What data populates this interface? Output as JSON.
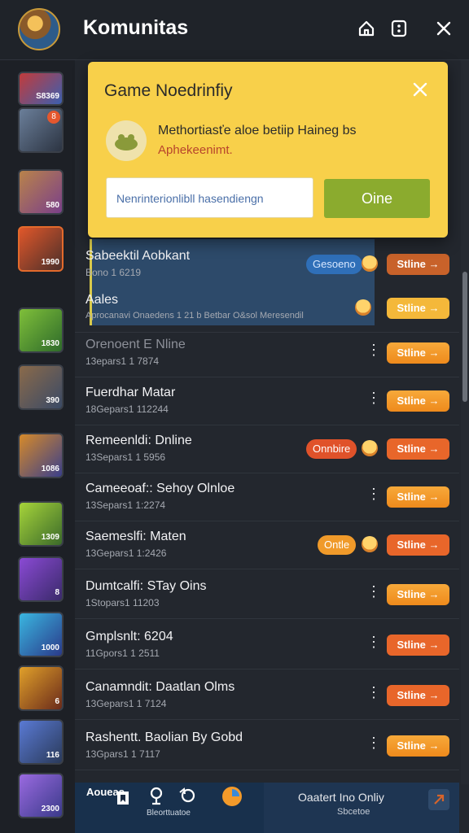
{
  "header": {
    "title": "Komunitas",
    "icons": [
      "home-icon",
      "dice-icon",
      "close-icon"
    ]
  },
  "rail": {
    "avatars": [
      {
        "badge": "S8369"
      },
      {
        "badge": "",
        "count": "8"
      },
      {
        "badge": "580"
      },
      {
        "badge": "1990"
      },
      {
        "badge": "1830"
      },
      {
        "badge": "390"
      },
      {
        "badge": "1086"
      },
      {
        "badge": "1309"
      },
      {
        "badge": "8"
      },
      {
        "badge": "1000"
      },
      {
        "badge": "6"
      },
      {
        "badge": "116"
      },
      {
        "badge": "2300"
      }
    ]
  },
  "popup": {
    "title": "Game Noedrinfiy",
    "message": "Methortiasťe aloe betiip Haineg bs",
    "note": "Aphekeenimt.",
    "input_value": "Nenrinterionlibll hasendiengn",
    "button": "Oine"
  },
  "rows": [
    {
      "name": "Sabeektil Aobkant",
      "sub": "Bono 1 6219",
      "tag": "Gesoeno",
      "action": "Stline"
    },
    {
      "name": "Aales",
      "sub": "Aprocanavi Onaedens 1 21 b Betbar O&sol Meresendil",
      "action": "Stline"
    },
    {
      "name": "Orenoent E Nline",
      "sub": "13epars1 1 7874",
      "action": "Stline"
    },
    {
      "name": "Fuerdhar Matar",
      "sub": "18Gepars1 112244",
      "action": "Stline"
    },
    {
      "name": "Remeenldi: Dnline",
      "sub": "13Separs1 1 5956",
      "tag": "Onnbire",
      "action": "Stline"
    },
    {
      "name": "Cameeoaf:: Sehoy Olnloe",
      "sub": "13Separs1 1:2274",
      "action": "Stline"
    },
    {
      "name": "Saemeslfi: Maten",
      "sub": "13Gepars1 1:2426",
      "tag": "Ontle",
      "action": "Stline"
    },
    {
      "name": "Dumtcalfi: STay Oins",
      "sub": "1Stopars1 11203",
      "action": "Stline"
    },
    {
      "name": "Gmplsnlt: 6204",
      "sub": "11Gpors1 1 2511",
      "action": "Stline"
    },
    {
      "name": "Canamndit: Daatlan Olms",
      "sub": "13Gepars1 1 7124",
      "action": "Stline"
    },
    {
      "name": "Rashentt. Baolian By Gobd",
      "sub": "13Gpars1 1 7117",
      "action": "Stline"
    }
  ],
  "bottom_bar": {
    "title": "Aoueas",
    "label": "Bleorttuatoe",
    "right_title": "Oaatert Ino Onliy",
    "right_sub": "Sbcetoe"
  },
  "colors": {
    "background": "#23272e",
    "popup": "#f8d04a",
    "online_button": "#ee8a1c",
    "popup_button": "#8bab2e"
  }
}
